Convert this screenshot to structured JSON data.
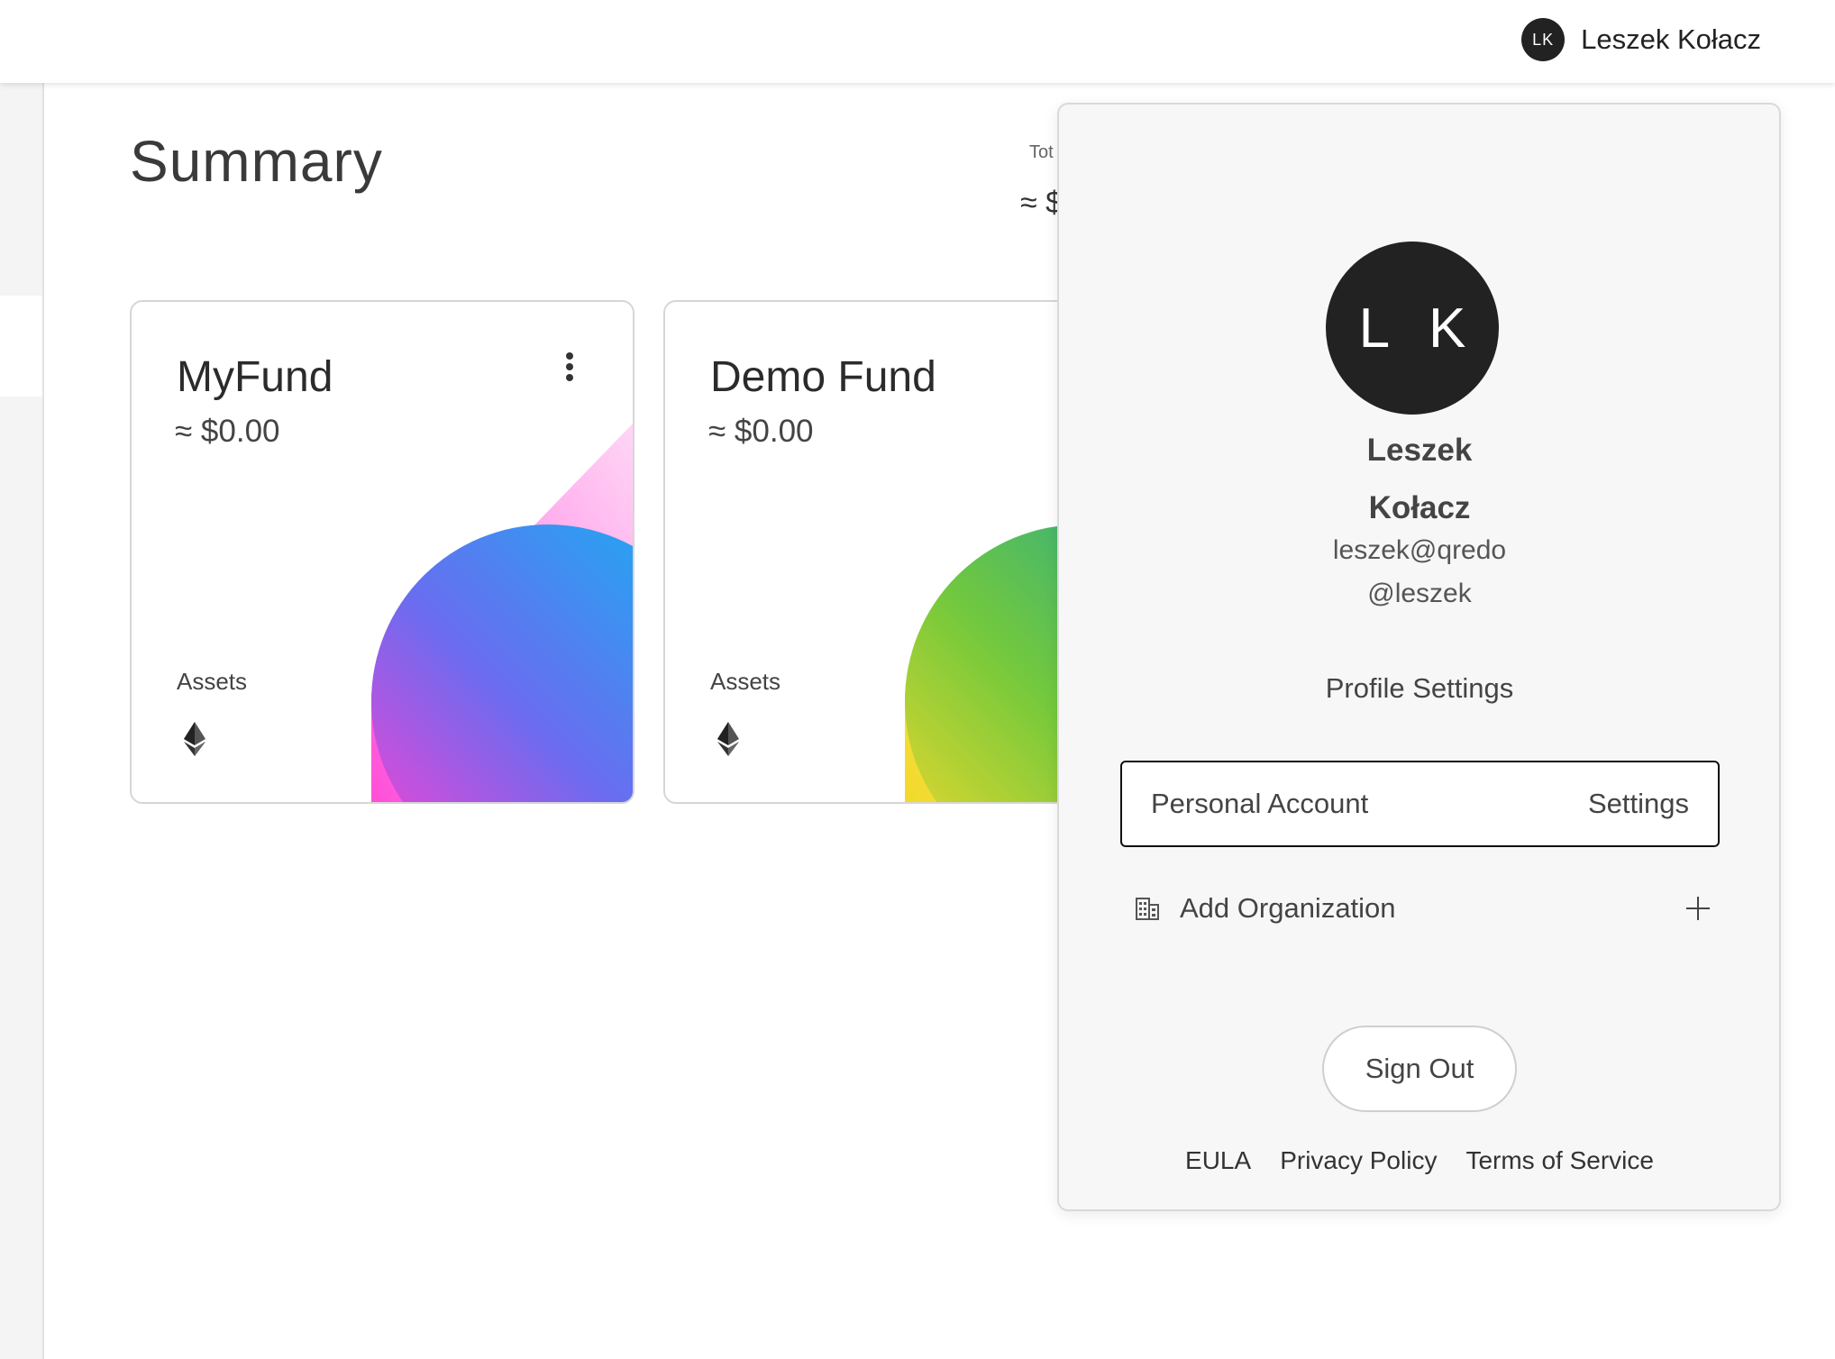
{
  "topbar": {
    "user_initials": "LK",
    "user_name": "Leszek Kołacz"
  },
  "main": {
    "title": "Summary",
    "total_label": "Tot",
    "total_value": "≈ $"
  },
  "funds": [
    {
      "name": "MyFund",
      "value": "≈ $0.00",
      "assets_label": "Assets",
      "asset_icons": [
        "ethereum-icon"
      ],
      "art_colors": [
        "#ff4fd8",
        "#1aa7f0"
      ]
    },
    {
      "name": "Demo Fund",
      "value": "≈ $0.00",
      "assets_label": "Assets",
      "asset_icons": [
        "ethereum-icon"
      ],
      "art_colors": [
        "#f5e23a",
        "#22b68a"
      ]
    }
  ],
  "profile_popover": {
    "initials": "L K",
    "first_name": "Leszek",
    "last_name": "Kołacz",
    "email": "leszek@qredo",
    "handle": "@leszek",
    "profile_settings_label": "Profile Settings",
    "account": {
      "name": "Personal Account",
      "settings_label": "Settings"
    },
    "add_org": {
      "label": "Add Organization",
      "icon": "building-icon",
      "action_icon": "plus-icon"
    },
    "sign_out_label": "Sign Out",
    "footer_links": [
      "EULA",
      "Privacy Policy",
      "Terms of Service"
    ]
  }
}
